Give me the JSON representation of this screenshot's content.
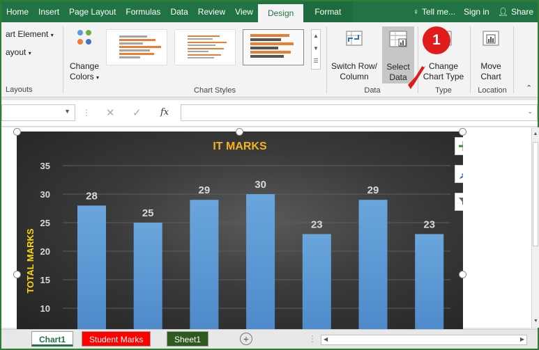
{
  "tabs": [
    "Home",
    "Insert",
    "Page Layout",
    "Formulas",
    "Data",
    "Review",
    "View",
    "Design",
    "Format"
  ],
  "tabs_right": {
    "tell_me": "Tell me...",
    "sign_in": "Sign in",
    "share": "Share"
  },
  "ribbon": {
    "add_chart_element": "art Element",
    "quick_layout": "ayout",
    "layouts_label": "Layouts",
    "change_colors_1": "Change",
    "change_colors_2": "Colors",
    "chart_styles_label": "Chart Styles",
    "switch_1": "Switch Row/",
    "switch_2": "Column",
    "select_1": "Select",
    "select_2": "Data",
    "data_label": "Data",
    "change_type_1": "Change",
    "change_type_2": "Chart Type",
    "type_label": "Type",
    "move_1": "Move",
    "move_2": "Chart",
    "location_label": "Location"
  },
  "formula_bar": {
    "fx": "fx",
    "value": ""
  },
  "callout": "1",
  "sheets": [
    "Chart1",
    "Student Marks",
    "Sheet1"
  ],
  "colors": {
    "excel_green": "#217346",
    "bar": "#5b9bd5",
    "title": "#f6b221",
    "axis_title": "#ffd700",
    "callout": "#e01b1b"
  },
  "chart_data": {
    "type": "bar",
    "title": "IT MARKS",
    "ylabel": "TOTAL MARKS",
    "yticks": [
      10,
      15,
      20,
      25,
      30,
      35
    ],
    "ylim": [
      5,
      38
    ],
    "values": [
      28,
      25,
      29,
      30,
      23,
      29,
      23
    ],
    "data_labels": [
      "28",
      "25",
      "29",
      "30",
      "23",
      "29",
      "23"
    ],
    "grid": true
  }
}
